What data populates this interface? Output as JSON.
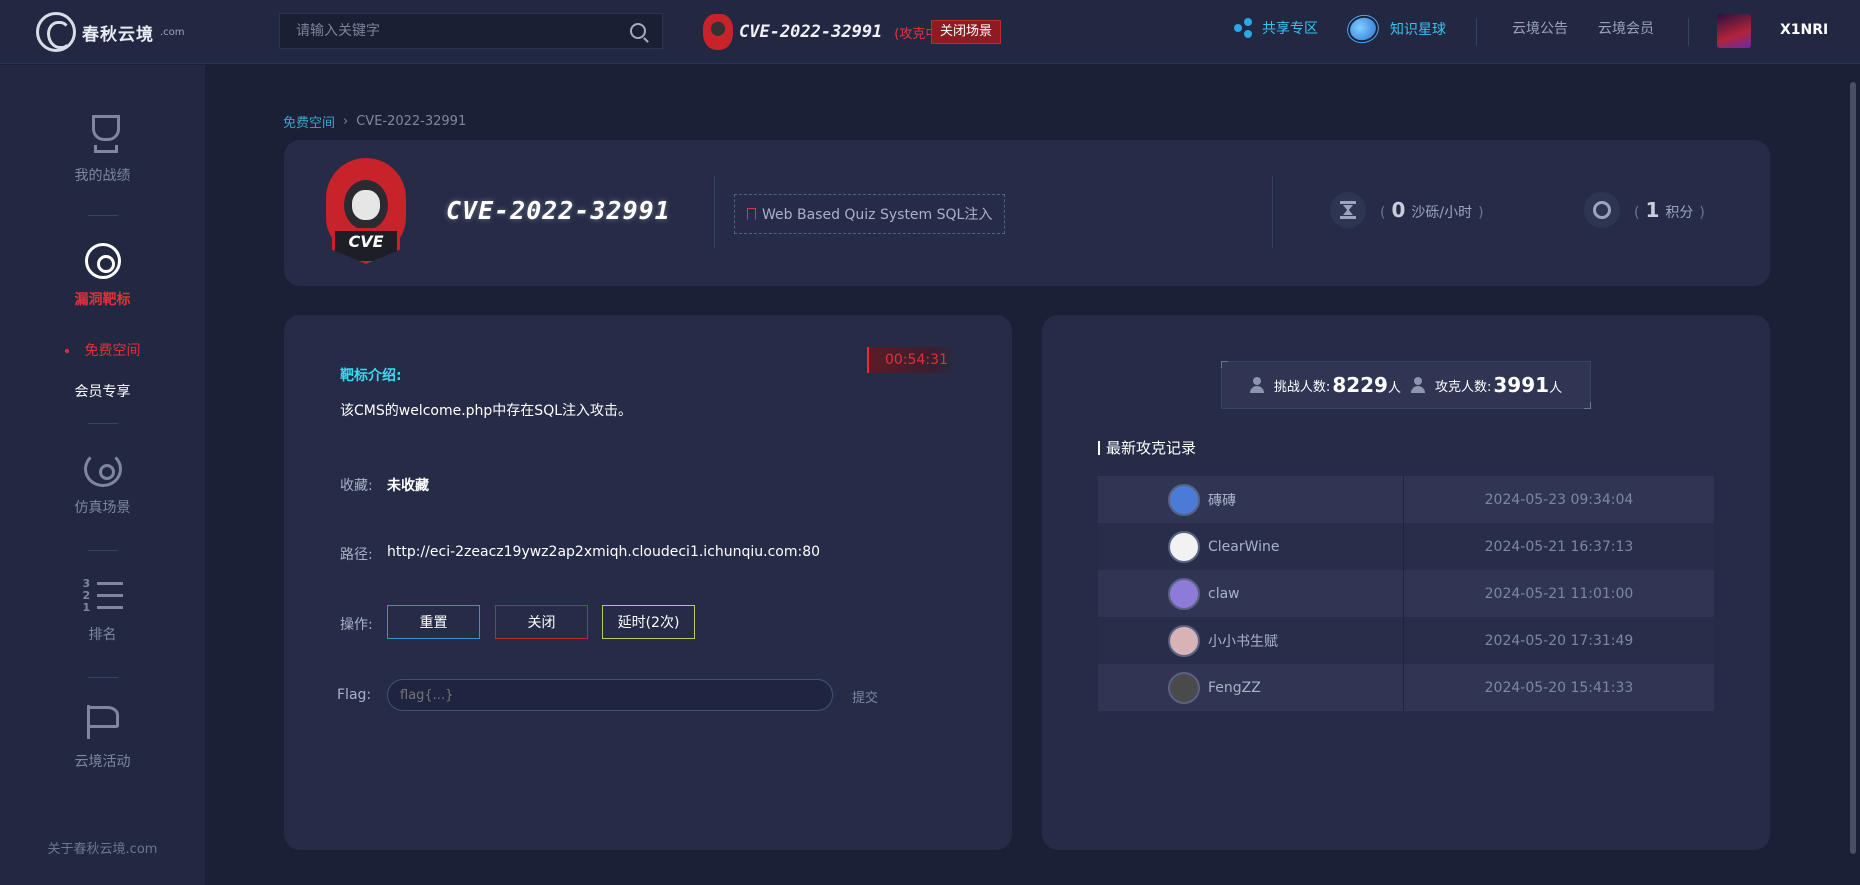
{
  "header": {
    "logo_text": "春秋云境",
    "logo_suffix": ".com",
    "search_placeholder": "请输入关键字",
    "cve_title": "CVE-2022-32991",
    "cve_status": "(攻克中)",
    "close_scene": "关闭场景",
    "nav": [
      {
        "label": "共享专区",
        "icon": "share-icon"
      },
      {
        "label": "知识星球",
        "icon": "planet-icon"
      }
    ],
    "links": [
      "云境公告",
      "云境会员"
    ],
    "username": "X1NRI"
  },
  "sidebar": {
    "items": [
      {
        "label": "我的战绩",
        "icon": "trophy-icon"
      },
      {
        "label": "漏洞靶标",
        "icon": "target-icon",
        "active": true
      },
      {
        "label": "仿真场景",
        "icon": "simulation-icon"
      },
      {
        "label": "排名",
        "icon": "ranking-icon"
      },
      {
        "label": "云境活动",
        "icon": "flag-icon"
      }
    ],
    "subitems": [
      "免费空间",
      "会员专享"
    ],
    "about": "关于春秋云境.com"
  },
  "breadcrumb": {
    "link": "免费空间",
    "current": "CVE-2022-32991"
  },
  "target": {
    "title": "CVE-2022-32991",
    "logo_text": "CVE",
    "tag": "Web Based Quiz System SQL注入",
    "cost_value": "0",
    "cost_unit": "沙砾/小时",
    "points_value": "1",
    "points_unit": "积分"
  },
  "detail": {
    "timer": "00:54:31",
    "intro_label": "靶标介绍:",
    "intro_text": "该CMS的welcome.php中存在SQL注入攻击。",
    "fav_label": "收藏:",
    "fav_value": "未收藏",
    "path_label": "路径:",
    "path_value": "http://eci-2zeacz19ywz2ap2xmiqh.cloudeci1.ichunqiu.com:80",
    "ops_label": "操作:",
    "btn_reset": "重置",
    "btn_close": "关闭",
    "btn_extend": "延时(2次)",
    "flag_label": "Flag:",
    "flag_placeholder": "flag{...}",
    "submit": "提交"
  },
  "stats": {
    "challengers_label": "挑战人数:",
    "challengers_value": "8229",
    "challengers_unit": "人",
    "solvers_label": "攻克人数:",
    "solvers_value": "3991",
    "solvers_unit": "人",
    "records_title": "最新攻克记录",
    "records": [
      {
        "user": "磚磚",
        "time": "2024-05-23 09:34:04",
        "avatar_color": "#4a7bd6"
      },
      {
        "user": "ClearWine",
        "time": "2024-05-21 16:37:13",
        "avatar_color": "#f2f2f2"
      },
      {
        "user": "claw",
        "time": "2024-05-21 11:01:00",
        "avatar_color": "#8e7ad8"
      },
      {
        "user": "小小书生赋",
        "time": "2024-05-20 17:31:49",
        "avatar_color": "#d7b3b8"
      },
      {
        "user": "FengZZ",
        "time": "2024-05-20 15:41:33",
        "avatar_color": "#4a4a4a"
      }
    ]
  },
  "colors": {
    "accent_red": "#e0313a",
    "accent_cyan": "#3dd7f0",
    "link_blue": "#3ea4c8"
  }
}
